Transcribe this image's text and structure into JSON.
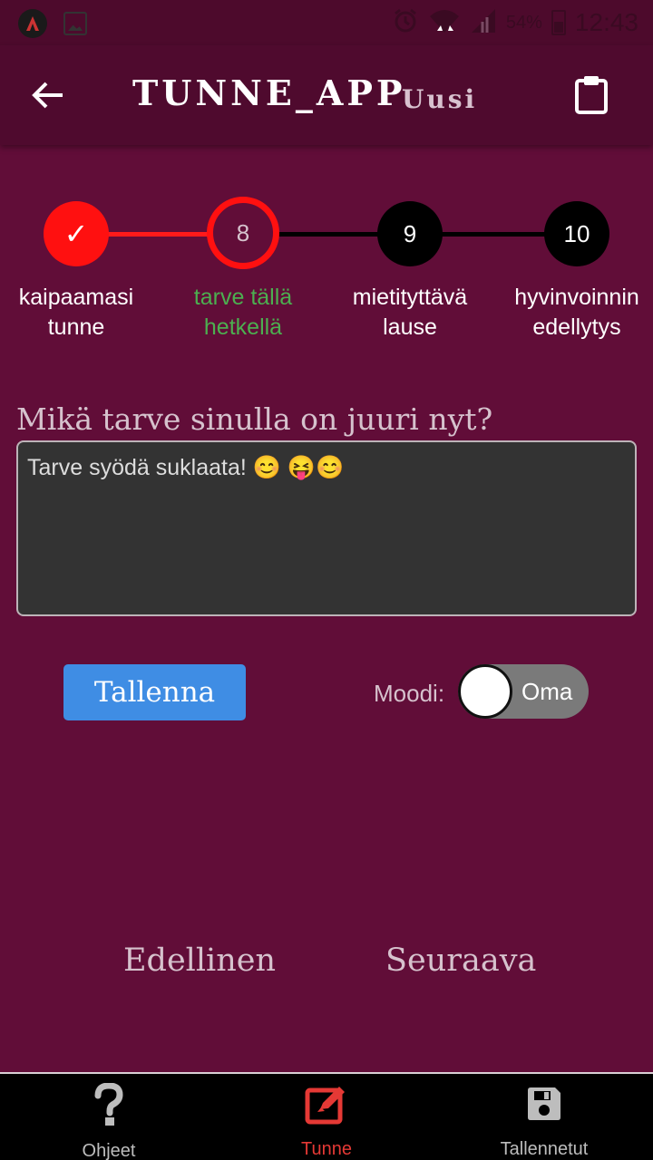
{
  "status_bar": {
    "battery": "54%",
    "time": "12:43"
  },
  "header": {
    "title": "TUNNE_APP",
    "subtitle": "Uusi"
  },
  "stepper": {
    "steps": [
      {
        "number": "✓",
        "label_line1": "kaipaamasi",
        "label_line2": "tunne",
        "state": "done"
      },
      {
        "number": "8",
        "label_line1": "tarve tällä",
        "label_line2": "hetkellä",
        "state": "active"
      },
      {
        "number": "9",
        "label_line1": "mietityttävä",
        "label_line2": "lause",
        "state": "pending"
      },
      {
        "number": "10",
        "label_line1": "hyvinvoinnin",
        "label_line2": "edellytys",
        "state": "pending"
      }
    ]
  },
  "main": {
    "question": "Mikä tarve sinulla on juuri nyt?",
    "answer": "Tarve syödä suklaata! 😊 😝😊",
    "save_label": "Tallenna",
    "mode_label": "Moodi:",
    "mode_value": "Oma"
  },
  "navigation": {
    "previous": "Edellinen",
    "next": "Seuraava"
  },
  "tabbar": {
    "tabs": [
      {
        "label": "Ohjeet",
        "icon": "question-icon",
        "active": false
      },
      {
        "label": "Tunne",
        "icon": "edit-icon",
        "active": true
      },
      {
        "label": "Tallennetut",
        "icon": "save-icon",
        "active": false
      }
    ]
  },
  "colors": {
    "background": "#610d38",
    "header": "#4f0a2e",
    "accent_red": "#ff0000",
    "active_label": "#4caf50",
    "button_blue": "#3f8de4"
  }
}
